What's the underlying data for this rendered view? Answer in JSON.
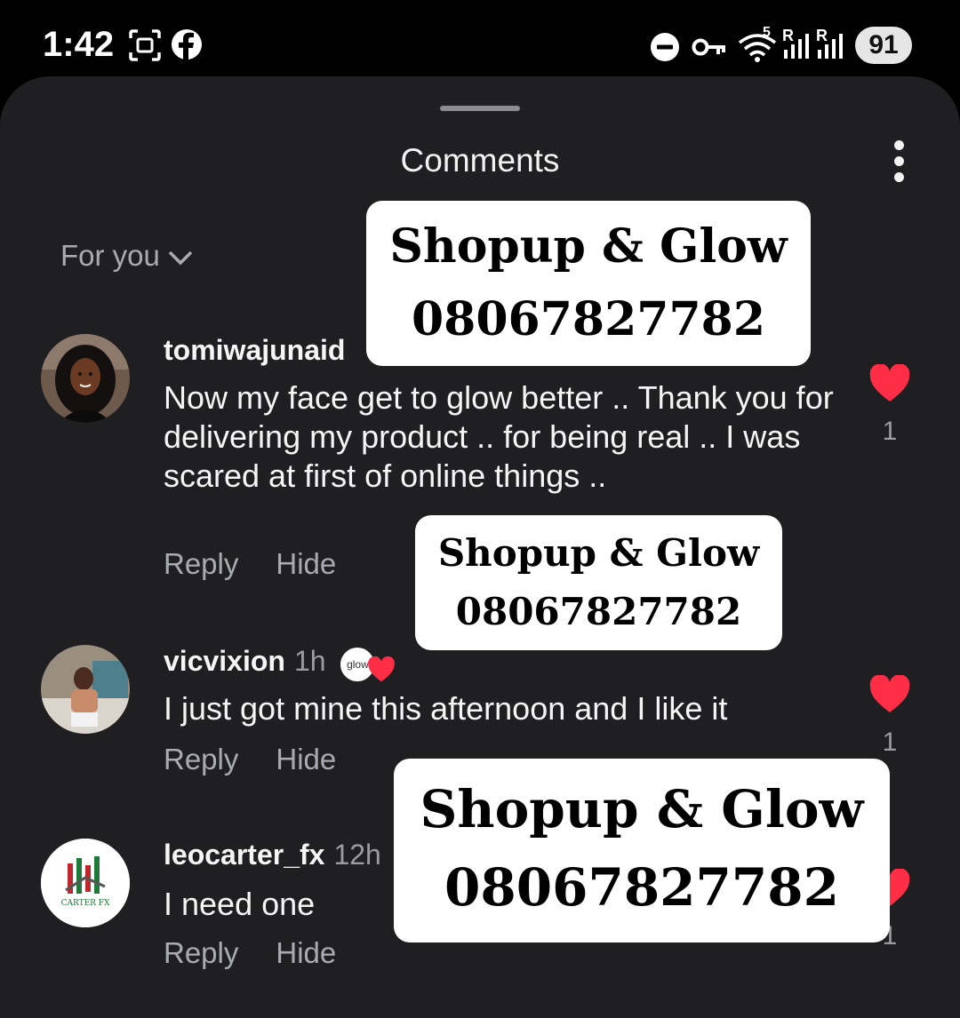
{
  "status": {
    "time": "1:42",
    "battery": "91",
    "network_label": "5",
    "signal_labels": [
      "R",
      "R"
    ]
  },
  "sheet": {
    "title": "Comments",
    "filter": "For you"
  },
  "comments": [
    {
      "username": "tomiwajunaid",
      "time": "",
      "text": "Now my face get to glow better .. Thank you for delivering my product .. for being real .. I was scared at first of online things ..",
      "reply": "Reply",
      "hide": "Hide",
      "likes": "1"
    },
    {
      "username": "vicvixion",
      "time": "1h",
      "creator_badge": "glow",
      "text": "I just got mine this afternoon and I like it",
      "reply": "Reply",
      "hide": "Hide",
      "likes": "1"
    },
    {
      "username": "leocarter_fx",
      "time": "12h",
      "text": "I need one",
      "reply": "Reply",
      "hide": "Hide",
      "likes": "1",
      "avatar_logo": "CARTER FX"
    }
  ],
  "watermarks": [
    {
      "line1": "Shopup & Glow",
      "line2": "08067827782"
    },
    {
      "line1": "Shopup & Glow",
      "line2": "08067827782"
    },
    {
      "line1": "Shopup & Glow",
      "line2": "08067827782"
    }
  ],
  "colors": {
    "sheet_bg": "#1f1f22",
    "like_red": "#ff2d45",
    "muted_text": "#a9abb0"
  },
  "icons": [
    "screenshot-icon",
    "facebook-icon",
    "dnd-icon",
    "key-icon",
    "wifi-icon",
    "signal-icon",
    "battery-icon",
    "more-vert-icon",
    "chevron-down-icon",
    "heart-icon"
  ]
}
